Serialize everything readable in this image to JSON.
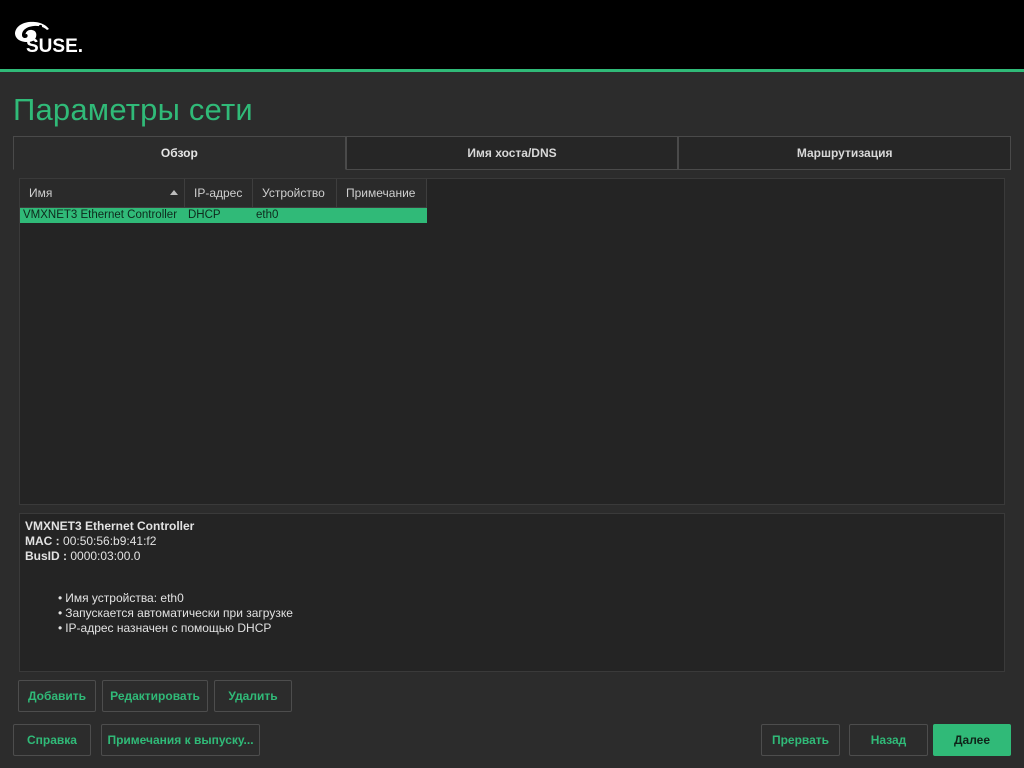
{
  "brand": {
    "logo_text": "SUSE.",
    "accent": "#30ba78"
  },
  "title": "Параметры сети",
  "tabs": [
    {
      "label": "Обзор",
      "active": true
    },
    {
      "label": "Имя хоста/DNS",
      "active": false
    },
    {
      "label": "Маршрутизация",
      "active": false
    }
  ],
  "table": {
    "columns": [
      "Имя",
      "IP-адрес",
      "Устройство",
      "Примечание"
    ],
    "sorted_column": "Имя",
    "rows": [
      {
        "name": "VMXNET3 Ethernet Controller",
        "ip": "DHCP",
        "device": "eth0",
        "note": "",
        "selected": true
      }
    ]
  },
  "details": {
    "title": "VMXNET3 Ethernet Controller",
    "mac_label": "MAC :",
    "mac_value": "00:50:56:b9:41:f2",
    "busid_label": "BusID :",
    "busid_value": "0000:03:00.0",
    "bullets": [
      "Имя устройства: eth0",
      "Запускается автоматически при загрузке",
      "IP-адрес назначен с помощью DHCP"
    ]
  },
  "actions": {
    "add": "Добавить",
    "edit": "Редактировать",
    "delete": "Удалить"
  },
  "footer": {
    "help": "Справка",
    "release_notes": "Примечания к выпуску...",
    "abort": "Прервать",
    "back": "Назад",
    "next": "Далее"
  }
}
